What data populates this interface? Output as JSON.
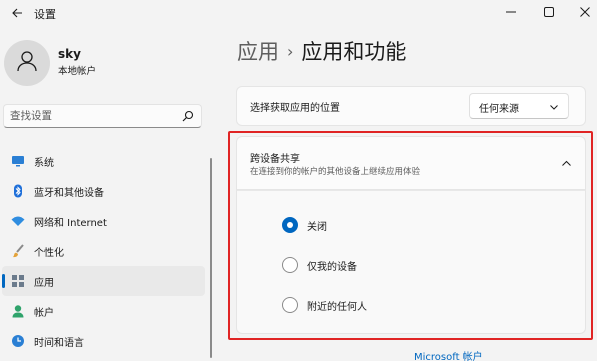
{
  "window": {
    "title": "设置"
  },
  "profile": {
    "name": "sky",
    "account_type": "本地帐户"
  },
  "search": {
    "placeholder": "查找设置"
  },
  "nav": {
    "items": [
      {
        "label": "系统",
        "icon": "monitor-icon",
        "color": "#2a7fd4",
        "selected": false
      },
      {
        "label": "蓝牙和其他设备",
        "icon": "bluetooth-icon",
        "color": "#1e6fd9",
        "selected": false
      },
      {
        "label": "网络和 Internet",
        "icon": "wifi-icon",
        "color": "#2f8de0",
        "selected": false
      },
      {
        "label": "个性化",
        "icon": "brush-icon",
        "color": "#e3a23a",
        "selected": false
      },
      {
        "label": "应用",
        "icon": "apps-icon",
        "color": "#6b7b8c",
        "selected": true
      },
      {
        "label": "帐户",
        "icon": "person-icon",
        "color": "#2fa36b",
        "selected": false
      },
      {
        "label": "时间和语言",
        "icon": "globe-clock-icon",
        "color": "#2a7fd4",
        "selected": false
      }
    ]
  },
  "breadcrumb": {
    "parent": "应用",
    "separator": "›",
    "current": "应用和功能"
  },
  "location": {
    "label": "选择获取应用的位置",
    "selected": "任何来源"
  },
  "share": {
    "title": "跨设备共享",
    "description": "在连接到你的帐户的其他设备上继续应用体验",
    "options": [
      {
        "label": "关闭",
        "checked": true
      },
      {
        "label": "仅我的设备",
        "checked": false
      },
      {
        "label": "附近的任何人",
        "checked": false
      }
    ]
  },
  "footer": {
    "link": "Microsoft 帐户"
  },
  "colors": {
    "accent": "#0067c0",
    "highlight": "#e02424",
    "background": "#f3f3f3"
  }
}
